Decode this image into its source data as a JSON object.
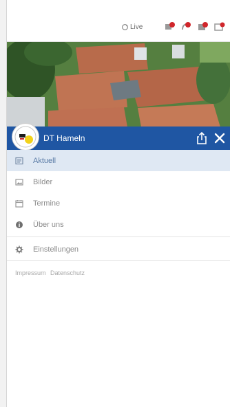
{
  "topbar": {
    "live_label": "Live",
    "icons": [
      "notification-add-icon",
      "notification-remove-icon",
      "calendar-add-icon",
      "calendar-remove-icon"
    ]
  },
  "header": {
    "club_name": "DT Hameln"
  },
  "nav": {
    "items": [
      {
        "label": "Aktuell",
        "icon": "news-icon",
        "active": true
      },
      {
        "label": "Bilder",
        "icon": "image-icon",
        "active": false
      },
      {
        "label": "Termine",
        "icon": "calendar-icon",
        "active": false
      },
      {
        "label": "Über uns",
        "icon": "info-icon",
        "active": false
      }
    ],
    "settings_label": "Einstellungen"
  },
  "footer": {
    "impressum": "Impressum",
    "datenschutz": "Datenschutz"
  },
  "colors": {
    "header_blue": "#1f56a3",
    "active_bg": "#dfe8f3",
    "badge_red": "#d0262b"
  }
}
